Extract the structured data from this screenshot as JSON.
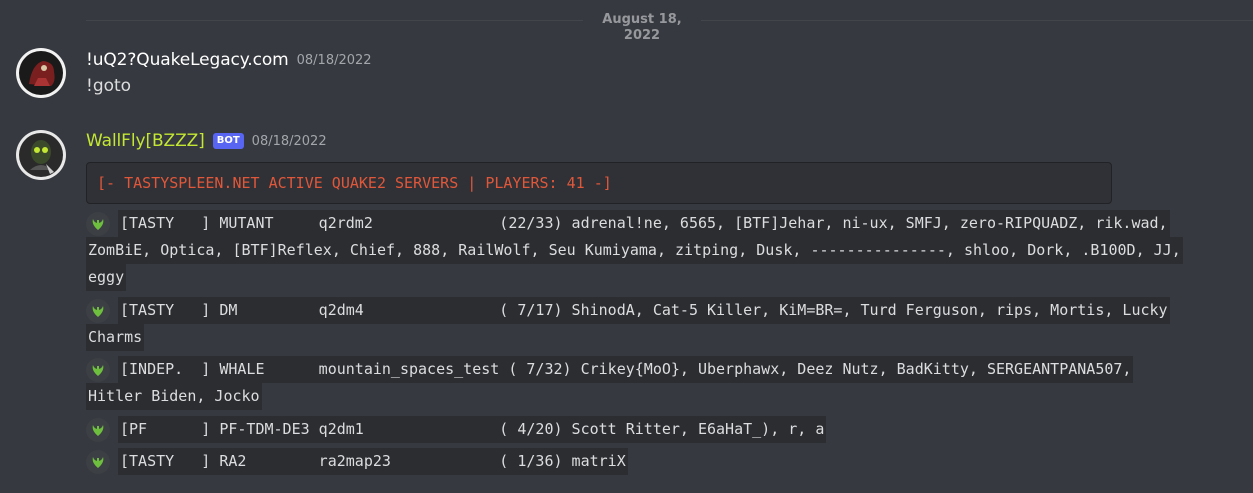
{
  "date_divider": "August 18, 2022",
  "messages": [
    {
      "username": "!uQ2?QuakeLegacy.com",
      "timestamp": "08/18/2022",
      "text": "!goto"
    },
    {
      "username": "WallFly[BZZZ]",
      "bot_tag": "BOT",
      "timestamp": "08/18/2022",
      "embed_text": "[- TASTYSPLEEN.NET ACTIVE QUAKE2 SERVERS | PLAYERS: 41 -]",
      "servers": [
        {
          "lines": [
            "[TASTY   ] MUTANT     q2rdm2              (22/33) adrenal!ne, 6565, [BTF]Jehar, ni-ux, SMFJ, zero-RIPQUADZ, rik.wad,",
            "ZomBiE, Optica, [BTF]Reflex, Chief, 888, RailWolf, Seu Kumiyama, zitping, Dusk, ---------------, shloo, Dork, .B100D, JJ,",
            "eggy"
          ]
        },
        {
          "lines": [
            "[TASTY   ] DM         q2dm4               ( 7/17) ShinodA, Cat-5 Killer, KiM=BR=, Turd Ferguson, rips, Mortis, Lucky",
            "Charms"
          ]
        },
        {
          "lines": [
            "[INDEP.  ] WHALE      mountain_spaces_test ( 7/32) Crikey{MoO}, Uberphawx, Deez Nutz, BadKitty, SERGEANTPANA507,",
            "Hitler Biden, Jocko"
          ]
        },
        {
          "lines": [
            "[PF      ] PF-TDM-DE3 q2dm1               ( 4/20) Scott Ritter, E6aHaT_), r, a"
          ]
        },
        {
          "lines": [
            "[TASTY   ] RA2        ra2map23            ( 1/36) matriX"
          ]
        }
      ]
    }
  ],
  "colors": {
    "background": "#36393f",
    "bot_name": "#c3e733",
    "bot_tag": "#5865f2",
    "embed_text": "#e1573a"
  }
}
